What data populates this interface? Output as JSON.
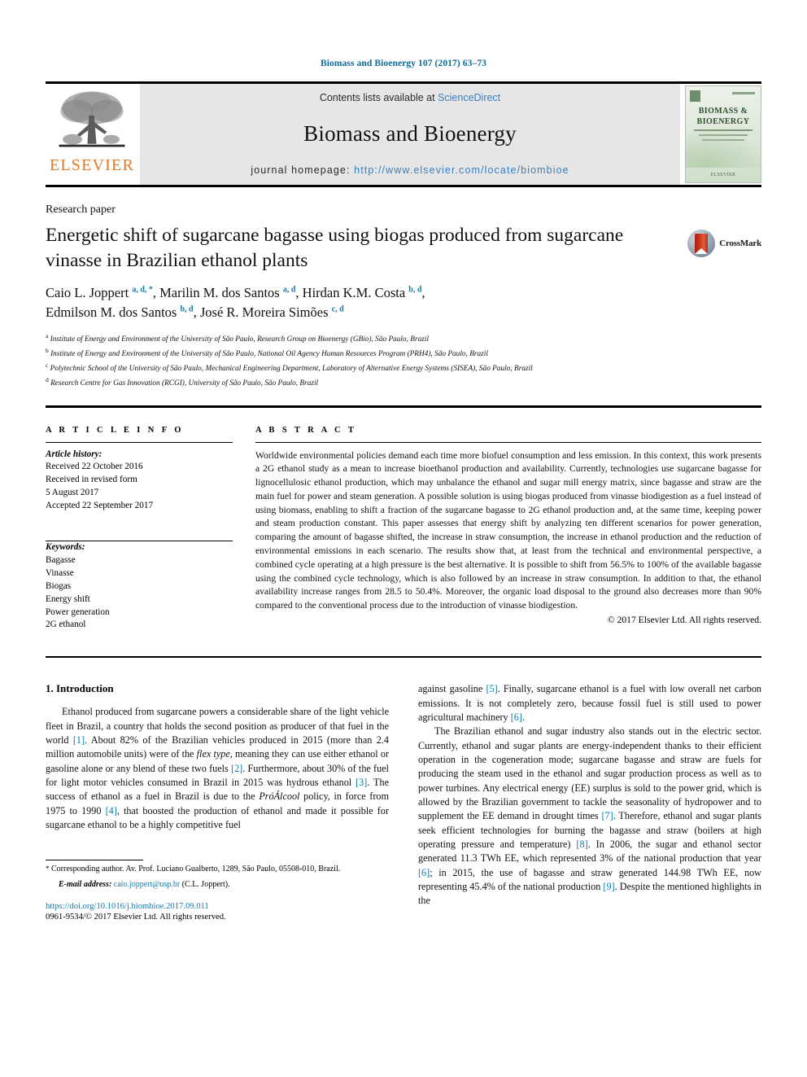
{
  "running_head": "Biomass and Bioenergy 107 (2017) 63–73",
  "masthead": {
    "publisher_logo_label": "ELSEVIER",
    "contents_prefix": "Contents lists available at ",
    "contents_link": "ScienceDirect",
    "journal_title": "Biomass and Bioenergy",
    "homepage_label": "journal homepage: ",
    "homepage_url": "http://www.elsevier.com/locate/biombioe",
    "cover": {
      "line1": "BIOMASS &",
      "line2": "BIOENERGY",
      "footer": "ELSEVIER"
    }
  },
  "article": {
    "type": "Research paper",
    "title": "Energetic shift of sugarcane bagasse using biogas produced from sugarcane vinasse in Brazilian ethanol plants",
    "crossmark_label": "CrossMark",
    "authors_line1_a": "Caio L. Joppert ",
    "authors_line1_a_sup": "a, d, *",
    "authors_line1_b": ", Marilin M. dos Santos ",
    "authors_line1_b_sup": "a, d",
    "authors_line1_c": ", Hirdan K.M. Costa ",
    "authors_line1_c_sup": "b, d",
    "authors_line1_d": ",",
    "authors_line2_a": "Edmilson M. dos Santos ",
    "authors_line2_a_sup": "b, d",
    "authors_line2_b": ", José R. Moreira Simões ",
    "authors_line2_b_sup": "c, d",
    "affiliations": [
      {
        "mark": "a",
        "text": "Institute of Energy and Environment of the University of São Paulo, Research Group on Bioenergy (GBio), São Paulo, Brazil"
      },
      {
        "mark": "b",
        "text": "Institute of Energy and Environment of the University of São Paulo, National Oil Agency Human Resources Program (PRH4), São Paulo, Brazil"
      },
      {
        "mark": "c",
        "text": "Polytechnic School of the University of São Paulo, Mechanical Engineering Department, Laboratory of Alternative Energy Systems (SISEA), São Paulo, Brazil"
      },
      {
        "mark": "d",
        "text": "Research Centre for Gas Innovation (RCGI), University of São Paulo, São Paulo, Brazil"
      }
    ]
  },
  "article_info": {
    "heading": "A R T I C L E  I N F O",
    "history_label": "Article history:",
    "history": [
      "Received 22 October 2016",
      "Received in revised form",
      "5 August 2017",
      "Accepted 22 September 2017"
    ],
    "keywords_label": "Keywords:",
    "keywords": [
      "Bagasse",
      "Vinasse",
      "Biogas",
      "Energy shift",
      "Power generation",
      "2G ethanol"
    ]
  },
  "abstract": {
    "heading": "A B S T R A C T",
    "text": "Worldwide environmental policies demand each time more biofuel consumption and less emission. In this context, this work presents a 2G ethanol study as a mean to increase bioethanol production and availability. Currently, technologies use sugarcane bagasse for lignocellulosic ethanol production, which may unbalance the ethanol and sugar mill energy matrix, since bagasse and straw are the main fuel for power and steam generation. A possible solution is using biogas produced from vinasse biodigestion as a fuel instead of using biomass, enabling to shift a fraction of the sugarcane bagasse to 2G ethanol production and, at the same time, keeping power and steam production constant. This paper assesses that energy shift by analyzing ten different scenarios for power generation, comparing the amount of bagasse shifted, the increase in straw consumption, the increase in ethanol production and the reduction of environmental emissions in each scenario. The results show that, at least from the technical and environmental perspective, a combined cycle operating at a high pressure is the best alternative. It is possible to shift from 56.5% to 100% of the available bagasse using the combined cycle technology, which is also followed by an increase in straw consumption. In addition to that, the ethanol availability increase ranges from 28.5 to 50.4%. Moreover, the organic load disposal to the ground also decreases more than 90% compared to the conventional process due to the introduction of vinasse biodigestion.",
    "copyright": "© 2017 Elsevier Ltd. All rights reserved."
  },
  "introduction": {
    "heading": "1. Introduction",
    "left_p1_part1": "Ethanol produced from sugarcane powers a considerable share of the light vehicle fleet in Brazil, a country that holds the second position as producer of that fuel in the world ",
    "left_p1_ref1": "[1]",
    "left_p1_part2": ". About 82% of the Brazilian vehicles produced in 2015 (more than 2.4 million automobile units) were of the ",
    "left_p1_italic1": "flex type",
    "left_p1_part3": ", meaning they can use either ethanol or gasoline alone or any blend of these two fuels ",
    "left_p1_ref2": "[2]",
    "left_p1_part4": ". Furthermore, about 30% of the fuel for light motor vehicles consumed in Brazil in 2015 was hydrous ethanol ",
    "left_p1_ref3": "[3]",
    "left_p1_part5": ". The success of ethanol as a fuel in Brazil is due to the ",
    "left_p1_italic2": "PróÁlcool",
    "left_p1_part6": " policy, in force from 1975 to 1990 ",
    "left_p1_ref4": "[4]",
    "left_p1_part7": ", that boosted the production of ethanol and made it possible for sugarcane ethanol to be a highly competitive fuel",
    "right_p1_part1": "against gasoline ",
    "right_p1_ref5": "[5]",
    "right_p1_part2": ". Finally, sugarcane ethanol is a fuel with low overall net carbon emissions. It is not completely zero, because fossil fuel is still used to power agricultural machinery ",
    "right_p1_ref6": "[6]",
    "right_p1_part3": ".",
    "right_p2_part1": "The Brazilian ethanol and sugar industry also stands out in the electric sector. Currently, ethanol and sugar plants are energy-independent thanks to their efficient operation in the cogeneration mode; sugarcane bagasse and straw are fuels for producing the steam used in the ethanol and sugar production process as well as to power turbines. Any electrical energy (EE) surplus is sold to the power grid, which is allowed by the Brazilian government to tackle the seasonality of hydropower and to supplement the EE demand in drought times ",
    "right_p2_ref7": "[7]",
    "right_p2_part2": ". Therefore, ethanol and sugar plants seek efficient technologies for burning the bagasse and straw (boilers at high operating pressure and temperature) ",
    "right_p2_ref8": "[8]",
    "right_p2_part3": ". In 2006, the sugar and ethanol sector generated 11.3 TWh EE, which represented 3% of the national production that year ",
    "right_p2_ref6b": "[6]",
    "right_p2_part4": "; in 2015, the use of bagasse and straw generated 144.98 TWh EE, now representing 45.4% of the national production ",
    "right_p2_ref9": "[9]",
    "right_p2_part5": ". Despite the mentioned highlights in the"
  },
  "footnotes": {
    "star": "*",
    "corresponding": " Corresponding author. Av. Prof. Luciano Gualberto, 1289, São Paulo, 05508-010, Brazil.",
    "email_label": "E-mail address:",
    "email": "caio.joppert@usp.br",
    "email_suffix": " (C.L. Joppert).",
    "doi": "https://doi.org/10.1016/j.biombioe.2017.09.011",
    "issn_line": "0961-9534/© 2017 Elsevier Ltd. All rights reserved."
  },
  "colors": {
    "link": "#0f7bac",
    "banner_bg": "#e6e6e6",
    "elsevier_orange": "#e87722"
  }
}
